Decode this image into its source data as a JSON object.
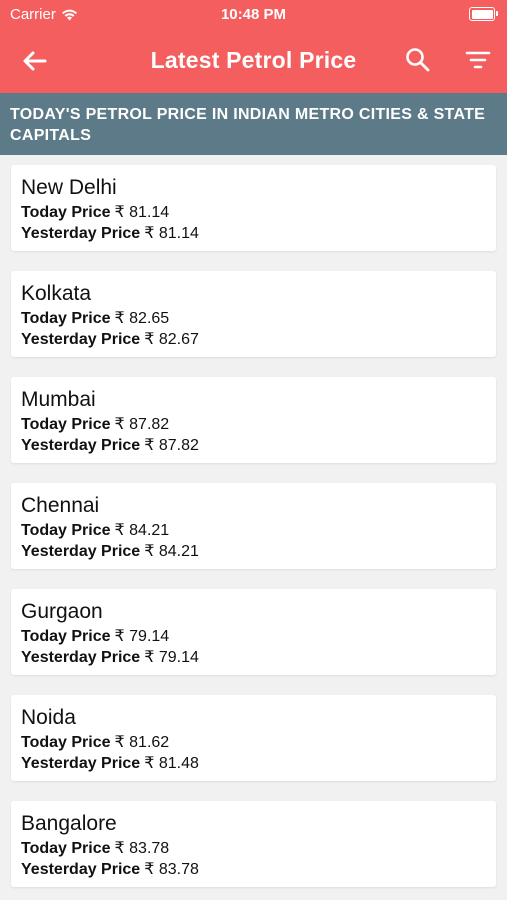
{
  "status_bar": {
    "carrier": "Carrier",
    "time": "10:48 PM"
  },
  "nav": {
    "title": "Latest Petrol Price",
    "back_icon": "arrow-left-icon",
    "search_icon": "search-icon",
    "filter_icon": "filter-icon"
  },
  "section": {
    "title": "TODAY'S PETROL PRICE IN INDIAN METRO CITIES & STATE CAPITALS"
  },
  "labels": {
    "today": "Today Price",
    "yesterday": "Yesterday Price",
    "currency": "₹"
  },
  "cities": [
    {
      "name": "New Delhi",
      "today": "₹ 81.14",
      "yesterday": "₹ 81.14"
    },
    {
      "name": "Kolkata",
      "today": "₹ 82.65",
      "yesterday": "₹ 82.67"
    },
    {
      "name": "Mumbai",
      "today": "₹ 87.82",
      "yesterday": "₹ 87.82"
    },
    {
      "name": "Chennai",
      "today": "₹ 84.21",
      "yesterday": "₹ 84.21"
    },
    {
      "name": "Gurgaon",
      "today": "₹ 79.14",
      "yesterday": "₹ 79.14"
    },
    {
      "name": "Noida",
      "today": "₹ 81.62",
      "yesterday": "₹ 81.48"
    },
    {
      "name": "Bangalore",
      "today": "₹ 83.78",
      "yesterday": "₹ 83.78"
    }
  ],
  "colors": {
    "header": "#f45e5e",
    "section": "#5d7a88",
    "background": "#f1f1f1"
  }
}
